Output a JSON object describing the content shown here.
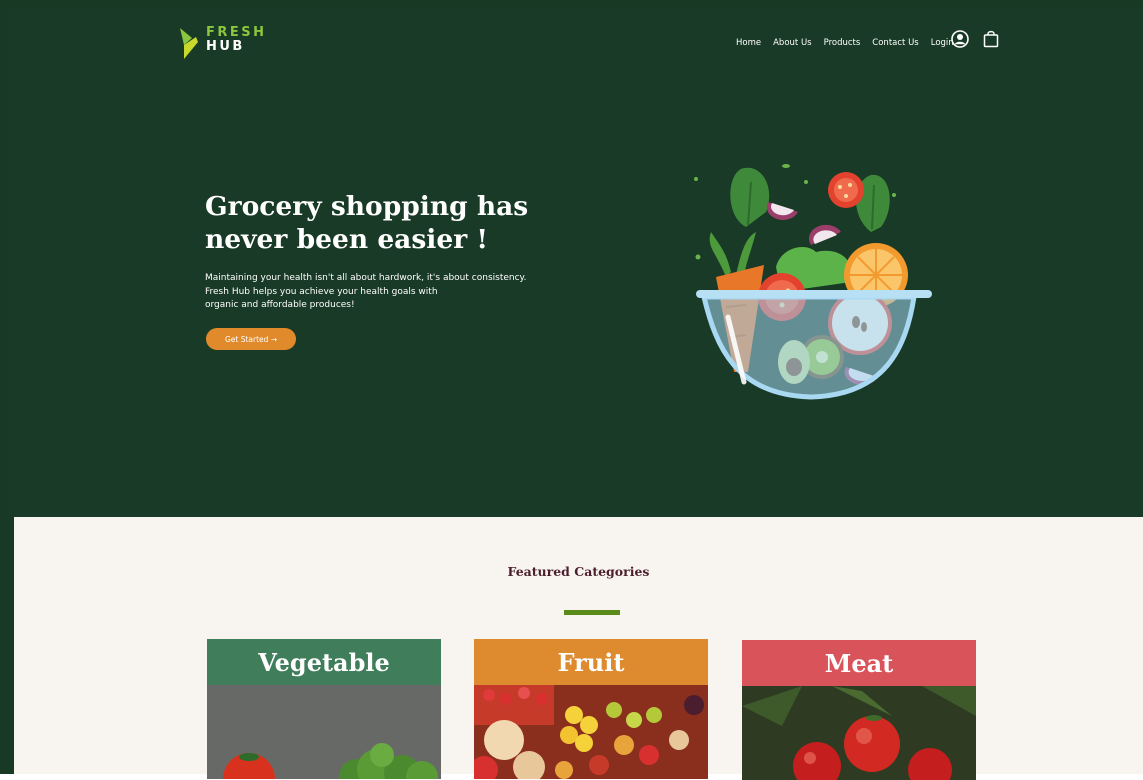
{
  "brand": {
    "line1": "FRESH",
    "line2": "HUB"
  },
  "nav": {
    "items": [
      "Home",
      "About Us",
      "Products",
      "Contact Us",
      "Login"
    ],
    "icons": [
      "user-icon",
      "shopping-bag-icon"
    ]
  },
  "hero": {
    "headline_line1": "Grocery shopping has",
    "headline_line2": "never been easier !",
    "sub_line1": "Maintaining your health isn't all about hardwork, it's about consistency.",
    "sub_line2": "Fresh  Hub helps you achieve your health goals with",
    "sub_line3": "organic and affordable produces!",
    "cta_label": "Get Started →"
  },
  "featured": {
    "title": "Featured Categories",
    "categories": [
      {
        "label": "Vegetable",
        "color": "#3f7d5b"
      },
      {
        "label": "Fruit",
        "color": "#de8a2e"
      },
      {
        "label": "Meat",
        "color": "#d9545a"
      }
    ]
  },
  "colors": {
    "hero_bg": "#193a26",
    "accent_green": "#8cc63f",
    "cta_orange": "#e08a2c",
    "section_bg": "#f8f4ef",
    "title_maroon": "#4a1e2e"
  }
}
